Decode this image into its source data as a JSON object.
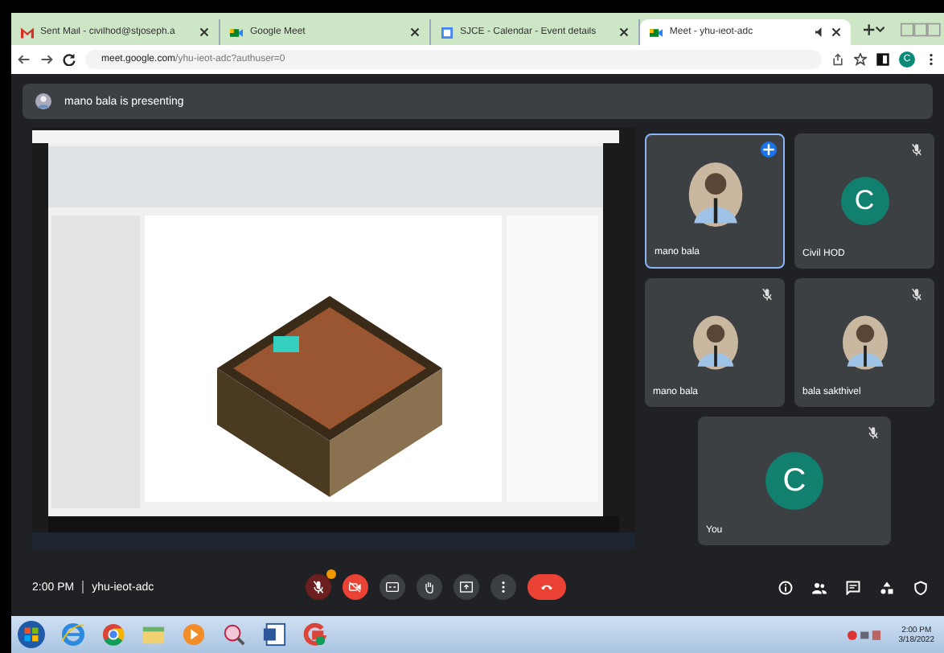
{
  "browser": {
    "tabs": [
      {
        "title": "Sent Mail - civilhod@stjoseph.a",
        "selected": false
      },
      {
        "title": "Google Meet",
        "selected": false
      },
      {
        "title": "SJCE - Calendar - Event details",
        "selected": false
      },
      {
        "title": "Meet - yhu-ieot-adc",
        "selected": true
      }
    ],
    "url_host": "meet.google.com",
    "url_path": "/yhu-ieot-adc?authuser=0",
    "profile_initial": "C"
  },
  "meet": {
    "presenting_banner": "mano bala is presenting",
    "tiles": [
      {
        "name": "mano bala",
        "speaking": true,
        "pinned": true,
        "muted": false
      },
      {
        "name": "Civil HOD",
        "kind": "letter",
        "initial": "C",
        "speaking": false,
        "pinned": false,
        "muted": true
      },
      {
        "name": "mano bala",
        "speaking": false,
        "pinned": false,
        "muted": true
      },
      {
        "name": "bala sakthivel",
        "speaking": false,
        "pinned": false,
        "muted": true
      },
      {
        "name": "You",
        "kind": "letter",
        "initial": "C",
        "speaking": false,
        "pinned": false,
        "muted": true
      }
    ],
    "time": "2:00 PM",
    "meeting_code": "yhu-ieot-adc",
    "mic_on": false,
    "camera_on": false
  },
  "taskbar": {
    "clock_time": "2:00 PM",
    "clock_date": "3/18/2022"
  }
}
